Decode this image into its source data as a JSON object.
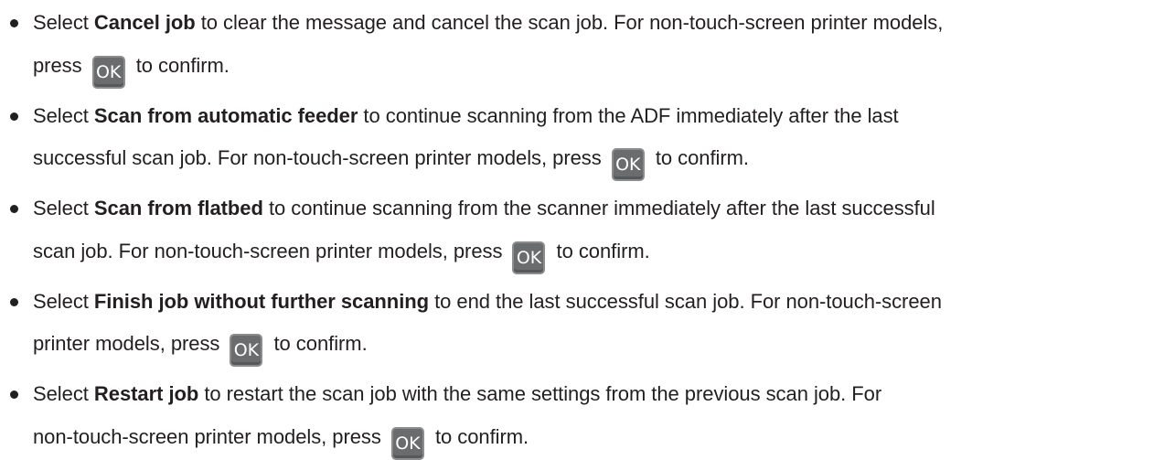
{
  "ok_key_label": "OK",
  "colors": {
    "text": "#231f20",
    "ok_key_fill": "#6a6c6e",
    "ok_key_border": "#8c8d8f",
    "ok_key_text": "#ffffff"
  },
  "items": [
    {
      "line1_pre": "Select ",
      "bold": "Cancel job",
      "line1_post": " to clear the message and cancel the scan job. For non-touch-screen printer models,",
      "line2_pre": "press",
      "line2_post": "to confirm."
    },
    {
      "line1_pre": "Select ",
      "bold": "Scan from automatic feeder",
      "line1_post": " to continue scanning from the ADF immediately after the last",
      "line2_pre": "successful scan job. For non-touch-screen printer models, press",
      "line2_post": "to confirm."
    },
    {
      "line1_pre": "Select ",
      "bold": "Scan from flatbed",
      "line1_post": " to continue scanning from the scanner immediately after the last successful",
      "line2_pre": "scan job. For non-touch-screen printer models, press",
      "line2_post": "to confirm."
    },
    {
      "line1_pre": "Select ",
      "bold": "Finish job without further scanning",
      "line1_post": " to end the last successful scan job. For non-touch-screen",
      "line2_pre": "printer models, press",
      "line2_post": "to confirm."
    },
    {
      "line1_pre": "Select ",
      "bold": "Restart job",
      "line1_post": " to restart the scan job with the same settings from the previous scan job. For",
      "line2_pre": "non-touch-screen printer models, press",
      "line2_post": "to confirm."
    }
  ]
}
